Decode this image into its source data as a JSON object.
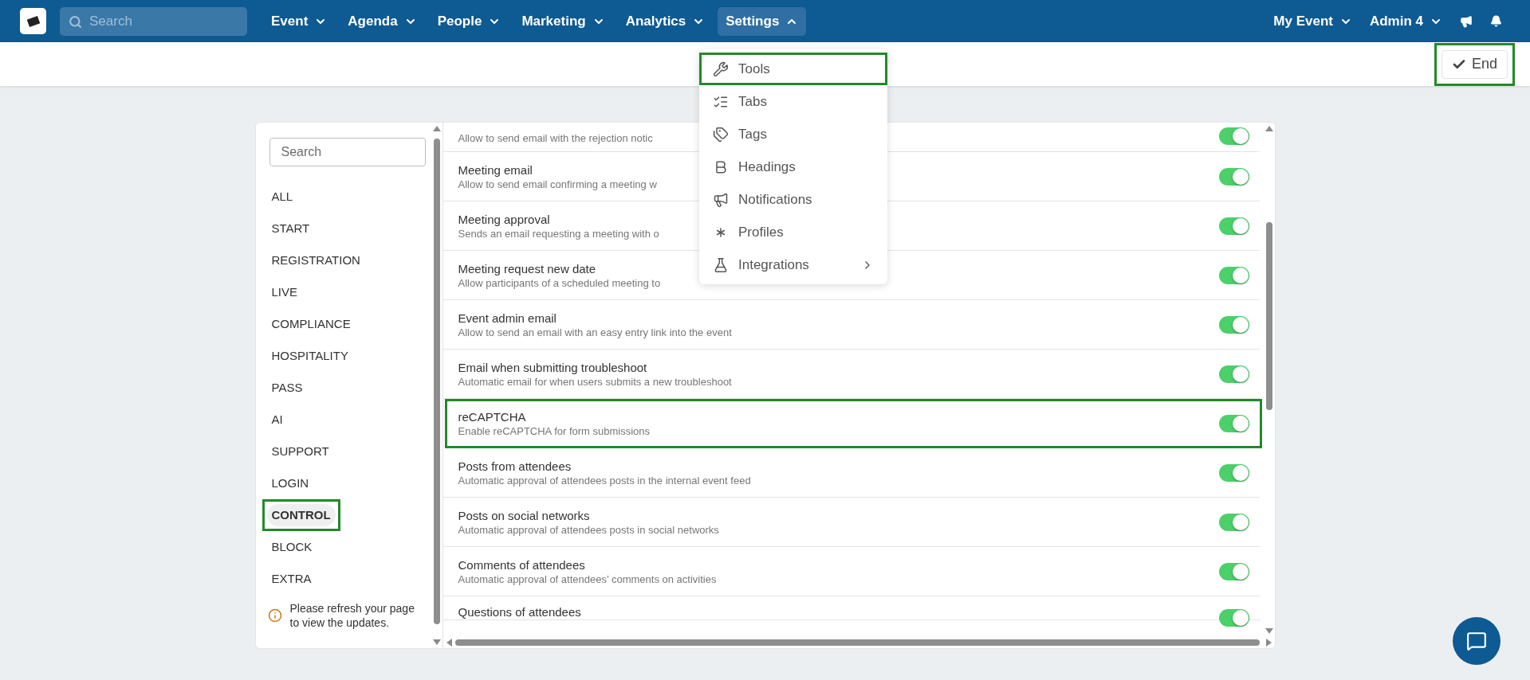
{
  "navbar": {
    "search": {
      "placeholder": "Search"
    },
    "menus": [
      {
        "label": "Event",
        "selected": false
      },
      {
        "label": "Agenda",
        "selected": false
      },
      {
        "label": "People",
        "selected": false
      },
      {
        "label": "Marketing",
        "selected": false
      },
      {
        "label": "Analytics",
        "selected": false
      },
      {
        "label": "Settings",
        "selected": true
      }
    ],
    "right_menus": [
      {
        "label": "My Event"
      },
      {
        "label": "Admin 4"
      }
    ]
  },
  "settings_menu": {
    "items": [
      {
        "label": "Tools",
        "kind": "item",
        "highlighted": true
      },
      {
        "label": "Tabs",
        "kind": "item",
        "highlighted": false
      },
      {
        "label": "Tags",
        "kind": "item",
        "highlighted": false
      },
      {
        "label": "Headings",
        "kind": "item",
        "highlighted": false
      },
      {
        "label": "Notifications",
        "kind": "item",
        "highlighted": false
      },
      {
        "label": "Profiles",
        "kind": "item",
        "highlighted": false
      },
      {
        "label": "Integrations",
        "kind": "submenu",
        "highlighted": false
      }
    ]
  },
  "toolbar": {
    "end_button": {
      "label": "End",
      "highlighted": true
    }
  },
  "sidebar": {
    "search": {
      "placeholder": "Search"
    },
    "items": [
      {
        "label": "ALL",
        "selected": false,
        "highlighted": false
      },
      {
        "label": "START",
        "selected": false,
        "highlighted": false
      },
      {
        "label": "REGISTRATION",
        "selected": false,
        "highlighted": false
      },
      {
        "label": "LIVE",
        "selected": false,
        "highlighted": false
      },
      {
        "label": "COMPLIANCE",
        "selected": false,
        "highlighted": false
      },
      {
        "label": "HOSPITALITY",
        "selected": false,
        "highlighted": false
      },
      {
        "label": "PASS",
        "selected": false,
        "highlighted": false
      },
      {
        "label": "AI",
        "selected": false,
        "highlighted": false
      },
      {
        "label": "SUPPORT",
        "selected": false,
        "highlighted": false
      },
      {
        "label": "LOGIN",
        "selected": false,
        "highlighted": false
      },
      {
        "label": "CONTROL",
        "selected": true,
        "highlighted": true
      },
      {
        "label": "BLOCK",
        "selected": false,
        "highlighted": false
      },
      {
        "label": "EXTRA",
        "selected": false,
        "highlighted": false
      }
    ],
    "notice": "Please refresh your page to view the updates."
  },
  "settings": [
    {
      "kind": "top",
      "description": "Allow to send email with the rejection notic",
      "on": true,
      "highlighted": false
    },
    {
      "kind": "full",
      "title": "Meeting email",
      "description": "Allow to send email confirming a meeting w",
      "on": true,
      "highlighted": false
    },
    {
      "kind": "full",
      "title": "Meeting approval",
      "description": "Sends an email requesting a meeting with o",
      "on": true,
      "highlighted": false
    },
    {
      "kind": "full",
      "title": "Meeting request new date",
      "description": "Allow participants of a scheduled meeting to",
      "on": true,
      "highlighted": false
    },
    {
      "kind": "full",
      "title": "Event admin email",
      "description": "Allow to send an email with an easy entry link into the event",
      "on": true,
      "highlighted": false
    },
    {
      "kind": "full",
      "title": "Email when submitting troubleshoot",
      "description": "Automatic email for when users submits a new troubleshoot",
      "on": true,
      "highlighted": false
    },
    {
      "kind": "full",
      "title": "reCAPTCHA",
      "description": "Enable reCAPTCHA for form submissions",
      "on": true,
      "highlighted": true
    },
    {
      "kind": "full",
      "title": "Posts from attendees",
      "description": "Automatic approval of attendees posts in the internal event feed",
      "on": true,
      "highlighted": false
    },
    {
      "kind": "full",
      "title": "Posts on social networks",
      "description": "Automatic approval of attendees posts in social networks",
      "on": true,
      "highlighted": false
    },
    {
      "kind": "full",
      "title": "Comments of attendees",
      "description": "Automatic approval of attendees’ comments on activities",
      "on": true,
      "highlighted": false
    },
    {
      "kind": "bottom",
      "title": "Questions of attendees",
      "on": true,
      "highlighted": false
    }
  ]
}
